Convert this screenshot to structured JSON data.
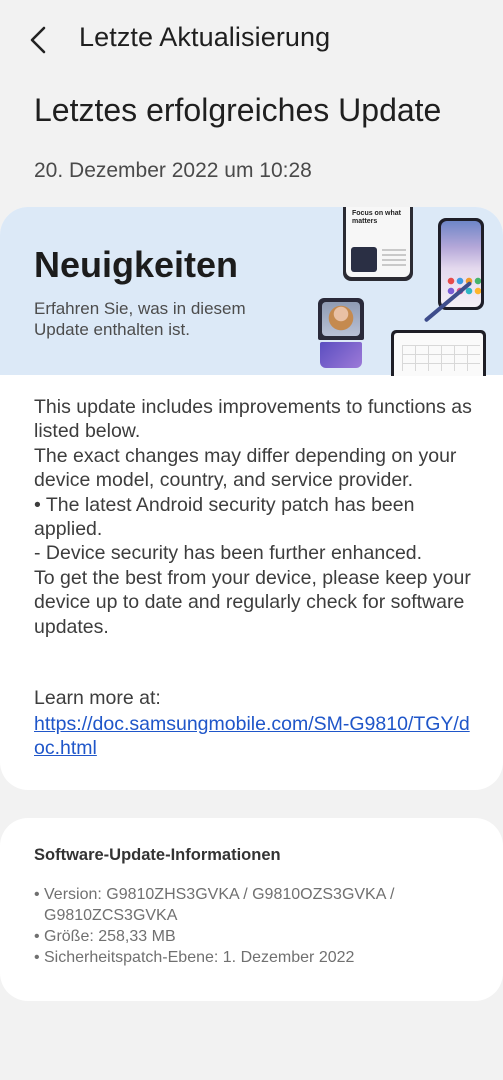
{
  "appbar": {
    "title": "Letzte Aktualisierung"
  },
  "header": {
    "heading": "Letztes erfolgreiches Update",
    "date": "20. Dezember 2022 um 10:28"
  },
  "news": {
    "title": "Neuigkeiten",
    "subtitle": "Erfahren Sie, was in diesem Update enthalten ist.",
    "illustration_text": "Focus on what matters",
    "body": "This update includes improvements to functions as listed below.\nThe exact changes may differ depending on your device model, country, and service provider.\n• The latest Android security patch has been applied.\n- Device security has been further enhanced.\nTo get the best from your device, please keep your device up to date and regularly check for software updates.",
    "learn_more_label": "Learn more at:",
    "link": "https://doc.samsungmobile.com/SM-G9810/TGY/doc.html"
  },
  "software_info": {
    "title": "Software-Update-Informationen",
    "bullet": "•",
    "version": "Version: G9810ZHS3GVKA / G9810OZS3GVKA / G9810ZCS3GVKA",
    "size": "Größe: 258,33 MB",
    "security_patch": "Sicherheitspatch-Ebene: 1. Dezember 2022"
  },
  "colors": {
    "background": "#f2f2f2",
    "banner": "#dce9f7",
    "link": "#1f56c9"
  },
  "icons": {
    "back": "chevron-left-icon"
  }
}
